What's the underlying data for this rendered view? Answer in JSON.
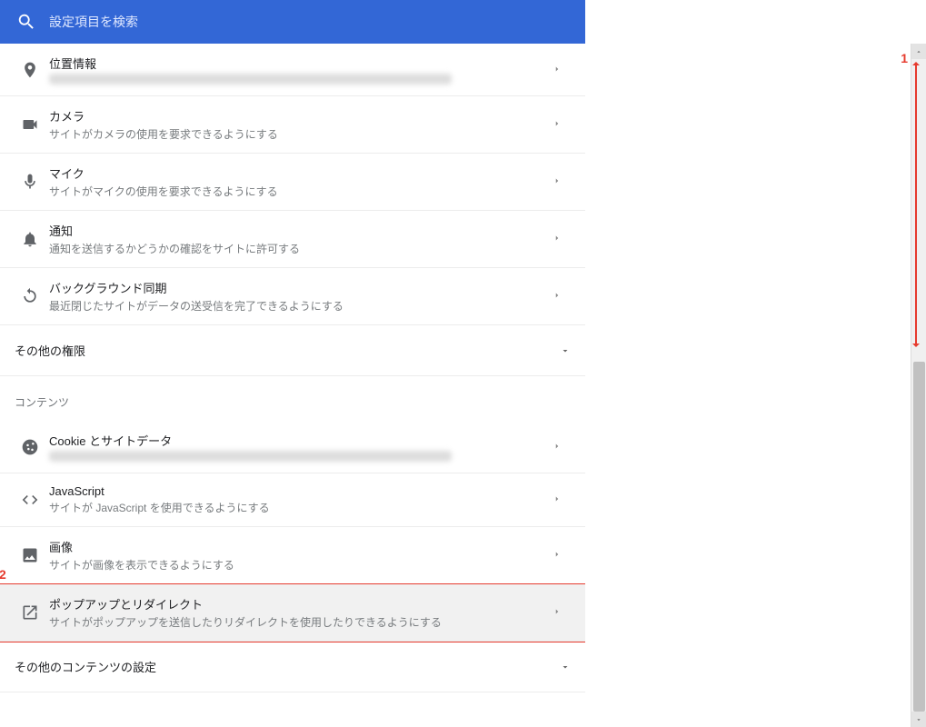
{
  "search": {
    "placeholder": "設定項目を検索"
  },
  "permissions_section": {
    "items": [
      {
        "id": "location",
        "title": "位置情報",
        "desc": "",
        "icon": "location-icon",
        "blurred": true
      },
      {
        "id": "camera",
        "title": "カメラ",
        "desc": "サイトがカメラの使用を要求できるようにする",
        "icon": "camera-icon"
      },
      {
        "id": "mic",
        "title": "マイク",
        "desc": "サイトがマイクの使用を要求できるようにする",
        "icon": "mic-icon"
      },
      {
        "id": "notify",
        "title": "通知",
        "desc": "通知を送信するかどうかの確認をサイトに許可する",
        "icon": "bell-icon"
      },
      {
        "id": "bgsync",
        "title": "バックグラウンド同期",
        "desc": "最近閉じたサイトがデータの送受信を完了できるようにする",
        "icon": "sync-icon"
      }
    ],
    "other_permissions": "その他の権限"
  },
  "contents_section": {
    "header": "コンテンツ",
    "items": [
      {
        "id": "cookies",
        "title": "Cookie とサイトデータ",
        "desc": "",
        "icon": "cookie-icon",
        "blurred": true
      },
      {
        "id": "js",
        "title": "JavaScript",
        "desc": "サイトが JavaScript を使用できるようにする",
        "icon": "code-icon"
      },
      {
        "id": "images",
        "title": "画像",
        "desc": "サイトが画像を表示できるようにする",
        "icon": "image-icon"
      },
      {
        "id": "popups",
        "title": "ポップアップとリダイレクト",
        "desc": "サイトがポップアップを送信したりリダイレクトを使用したりできるようにする",
        "icon": "popup-icon",
        "highlighted": true
      }
    ],
    "other_contents": "その他のコンテンツの設定"
  },
  "annotations": {
    "one": "1",
    "two": "2"
  }
}
